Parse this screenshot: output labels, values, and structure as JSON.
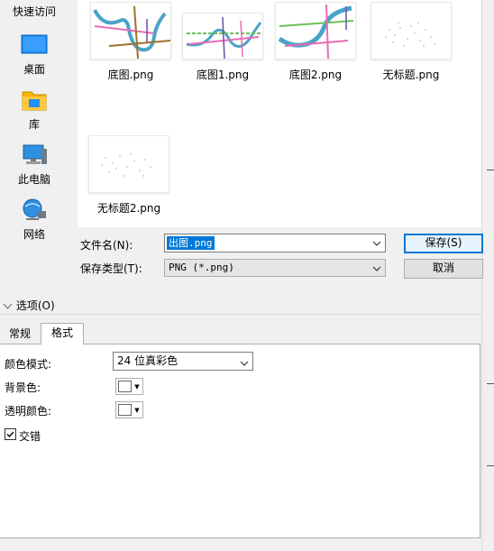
{
  "nav": {
    "items": [
      {
        "label": "快速访问",
        "icon": "star-icon"
      },
      {
        "label": "桌面",
        "icon": "desktop-icon"
      },
      {
        "label": "库",
        "icon": "library-icon"
      },
      {
        "label": "此电脑",
        "icon": "computer-icon"
      },
      {
        "label": "网络",
        "icon": "network-icon"
      }
    ]
  },
  "files": [
    {
      "name": "底图.png"
    },
    {
      "name": "底图1.png"
    },
    {
      "name": "底图2.png"
    },
    {
      "name": "无标题.png"
    },
    {
      "name": "无标题2.png"
    }
  ],
  "form": {
    "filename_label": "文件名(N):",
    "filename_value": "出图.png",
    "filetype_label": "保存类型(T):",
    "filetype_value": "PNG (*.png)",
    "save_label": "保存(S)",
    "cancel_label": "取消"
  },
  "options": {
    "toggle_label": "选项(O)",
    "tabs": [
      {
        "label": "常规",
        "active": false
      },
      {
        "label": "格式",
        "active": true
      }
    ],
    "color_mode_label": "颜色模式:",
    "color_mode_value": "24 位真彩色",
    "background_label": "背景色:",
    "transparent_label": "透明颜色:",
    "interlace_label": "交错",
    "interlace_checked": true
  },
  "colors": {
    "accent": "#0078d7",
    "river": "#4aa3c8",
    "pink_line": "#e86bb5",
    "green_line": "#6cbf5b",
    "brown_line": "#a0712b",
    "purple_line": "#6b4fa6"
  }
}
